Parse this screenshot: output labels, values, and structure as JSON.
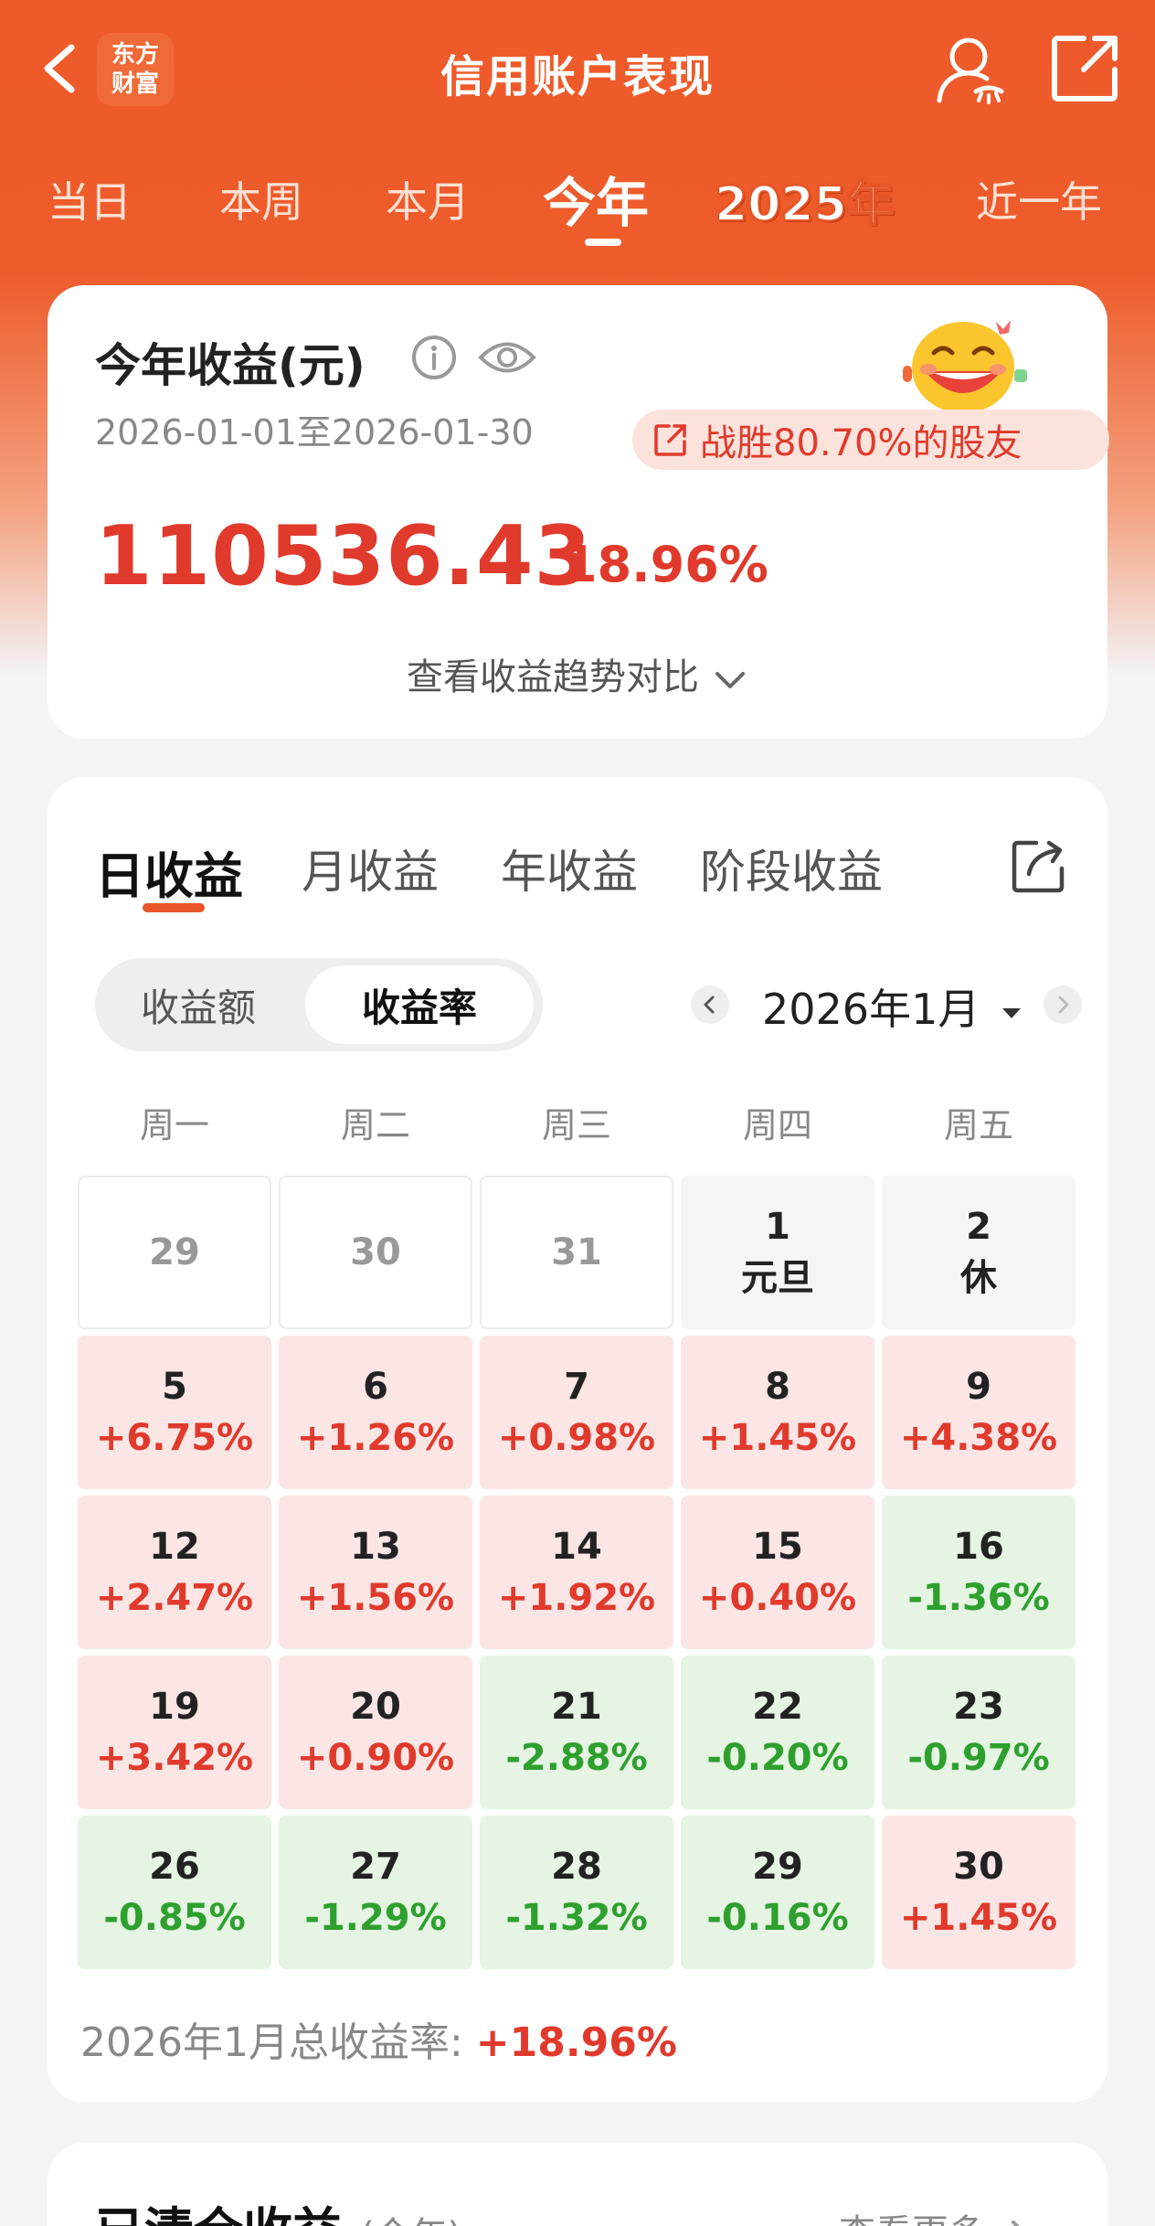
{
  "header": {
    "title": "信用账户表现",
    "logo_line1": "东方",
    "logo_line2": "财富"
  },
  "period_tabs": [
    "当日",
    "本周",
    "本月",
    "今年",
    "2025年",
    "近一年"
  ],
  "summary": {
    "title": "今年收益(元)",
    "date_range": "2026-01-01至2026-01-30",
    "beat_text": "战胜80.70%的股友",
    "amount": "110536.43",
    "rate": "18.96%",
    "trend_link": "查看收益趋势对比"
  },
  "sub_tabs": [
    "日收益",
    "月收益",
    "年收益",
    "阶段收益"
  ],
  "segment": {
    "amount_label": "收益额",
    "rate_label": "收益率"
  },
  "month_label": "2026年1月",
  "weekdays": [
    "周一",
    "周二",
    "周三",
    "周四",
    "周五"
  ],
  "calendar": [
    [
      {
        "day": "29",
        "value": "",
        "type": "empty"
      },
      {
        "day": "30",
        "value": "",
        "type": "empty"
      },
      {
        "day": "31",
        "value": "",
        "type": "empty"
      },
      {
        "day": "1",
        "value": "元旦",
        "type": "holiday"
      },
      {
        "day": "2",
        "value": "休",
        "type": "holiday"
      }
    ],
    [
      {
        "day": "5",
        "value": "+6.75%",
        "type": "up"
      },
      {
        "day": "6",
        "value": "+1.26%",
        "type": "up"
      },
      {
        "day": "7",
        "value": "+0.98%",
        "type": "up"
      },
      {
        "day": "8",
        "value": "+1.45%",
        "type": "up"
      },
      {
        "day": "9",
        "value": "+4.38%",
        "type": "up"
      }
    ],
    [
      {
        "day": "12",
        "value": "+2.47%",
        "type": "up"
      },
      {
        "day": "13",
        "value": "+1.56%",
        "type": "up"
      },
      {
        "day": "14",
        "value": "+1.92%",
        "type": "up"
      },
      {
        "day": "15",
        "value": "+0.40%",
        "type": "up"
      },
      {
        "day": "16",
        "value": "-1.36%",
        "type": "down"
      }
    ],
    [
      {
        "day": "19",
        "value": "+3.42%",
        "type": "up"
      },
      {
        "day": "20",
        "value": "+0.90%",
        "type": "up"
      },
      {
        "day": "21",
        "value": "-2.88%",
        "type": "down"
      },
      {
        "day": "22",
        "value": "-0.20%",
        "type": "down"
      },
      {
        "day": "23",
        "value": "-0.97%",
        "type": "down"
      }
    ],
    [
      {
        "day": "26",
        "value": "-0.85%",
        "type": "down"
      },
      {
        "day": "27",
        "value": "-1.29%",
        "type": "down"
      },
      {
        "day": "28",
        "value": "-1.32%",
        "type": "down"
      },
      {
        "day": "29",
        "value": "-0.16%",
        "type": "down"
      },
      {
        "day": "30",
        "value": "+1.45%",
        "type": "up"
      }
    ]
  ],
  "total": {
    "label": "2026年1月总收益率: ",
    "value": "+18.96%"
  },
  "bottom_card": {
    "title": "已清仓收益",
    "subtitle": "(今年)",
    "more": "查看更多"
  },
  "colors": {
    "brand": "#ee5a2a",
    "up": "#e03a2c",
    "down": "#2ea02e",
    "up_bg": "#fbe6e5",
    "down_bg": "#e5f4e3"
  }
}
